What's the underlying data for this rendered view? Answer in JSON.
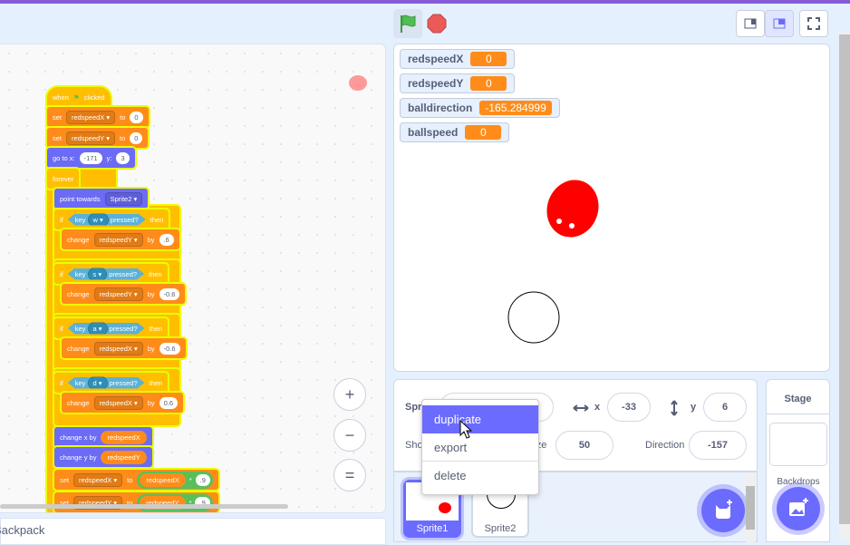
{
  "code": {
    "blocks": [
      [
        "when",
        "⚑",
        "clicked"
      ],
      [
        "set",
        {
          "dd": "redspeedX ▾"
        },
        "to",
        {
          "num": "0"
        }
      ],
      [
        "set",
        {
          "dd": "redspeedY ▾"
        },
        "to",
        {
          "num": "0"
        }
      ],
      [
        "go to x:",
        {
          "num": "-171"
        },
        "y:",
        {
          "num": "3"
        }
      ],
      [
        "forever"
      ],
      [
        "point towards",
        {
          "dd": "Sprite2 ▾"
        }
      ],
      [
        "if",
        {
          "bool": [
            "key",
            "w ▾",
            "pressed?"
          ]
        },
        "then"
      ],
      [
        "change",
        {
          "dd": "redspeedY ▾"
        },
        "by",
        {
          "num": ".6"
        }
      ],
      [
        "if",
        {
          "bool": [
            "key",
            "s ▾",
            "pressed?"
          ]
        },
        "then"
      ],
      [
        "change",
        {
          "dd": "redspeedY ▾"
        },
        "by",
        {
          "num": "-0.6"
        }
      ],
      [
        "if",
        {
          "bool": [
            "key",
            "a ▾",
            "pressed?"
          ]
        },
        "then"
      ],
      [
        "change",
        {
          "dd": "redspeedX ▾"
        },
        "by",
        {
          "num": "-0.6"
        }
      ],
      [
        "if",
        {
          "bool": [
            "key",
            "d ▾",
            "pressed?"
          ]
        },
        "then"
      ],
      [
        "change",
        {
          "dd": "redspeedX ▾"
        },
        "by",
        {
          "num": "0.6"
        }
      ],
      [
        "change x by",
        {
          "rep": "redspeedX"
        }
      ],
      [
        "change y by",
        {
          "rep": "redspeedY"
        }
      ],
      [
        "set",
        {
          "dd": "redspeedX ▾"
        },
        "to",
        {
          "op": [
            "redspeedX",
            "*",
            ".9"
          ]
        }
      ],
      [
        "set",
        {
          "dd": "redspeedY ▾"
        },
        "to",
        {
          "op": [
            "redspeedY",
            "*",
            ".9"
          ]
        }
      ]
    ],
    "zoom_in": "+",
    "zoom_out": "−",
    "zoom_reset": "="
  },
  "backpack": "Backpack",
  "monitors": [
    {
      "name": "redspeedX",
      "value": "0"
    },
    {
      "name": "redspeedY",
      "value": "0"
    },
    {
      "name": "balldirection",
      "value": "-165.284999"
    },
    {
      "name": "ballspeed",
      "value": "0"
    }
  ],
  "sprite_info": {
    "sprite_label": "Sprite",
    "x_label": "x",
    "x_value": "-33",
    "y_label": "y",
    "y_value": "6",
    "show_label": "Show",
    "size_label": "Size",
    "size_value": "50",
    "direction_label": "Direction",
    "direction_value": "-157"
  },
  "sprites": [
    {
      "name": "Sprite1",
      "selected": true
    },
    {
      "name": "Sprite2",
      "selected": false
    }
  ],
  "context_menu": [
    "duplicate",
    "export",
    "delete"
  ],
  "stage_panel": {
    "title": "Stage",
    "backdrops": "Backdrops"
  },
  "colors": {
    "accent": "#6b6bff",
    "events": "#ffbf00",
    "variables": "#ff8c1a",
    "motion": "#6b6bf5"
  }
}
